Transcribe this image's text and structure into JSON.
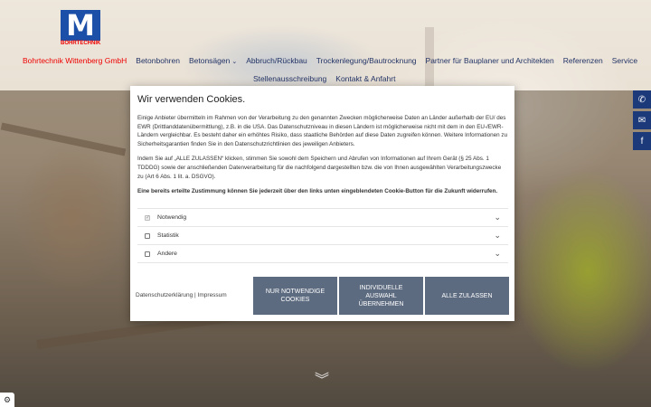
{
  "brand": {
    "logo_letter": "M",
    "logo_caption": "BOHRTECHNIK",
    "name": "Bohrtechnik Wittenberg GmbH"
  },
  "nav": {
    "row1": [
      {
        "label": "Bohrtechnik Wittenberg GmbH",
        "active": true
      },
      {
        "label": "Betonbohren"
      },
      {
        "label": "Betonsägen",
        "dropdown": true
      },
      {
        "label": "Abbruch/Rückbau"
      },
      {
        "label": "Trockenlegung/Bautrocknung"
      },
      {
        "label": "Partner für Bauplaner und Architekten"
      },
      {
        "label": "Referenzen"
      },
      {
        "label": "Service"
      }
    ],
    "row2": [
      {
        "label": "Stellenausschreibung"
      },
      {
        "label": "Kontakt & Anfahrt"
      }
    ]
  },
  "side_buttons": [
    {
      "icon": "phone-icon",
      "glyph": "✆"
    },
    {
      "icon": "email-icon",
      "glyph": "✉"
    },
    {
      "icon": "facebook-icon",
      "glyph": "f"
    }
  ],
  "cookie": {
    "title": "Wir verwenden Cookies.",
    "paragraph1": "Einige Anbieter übermitteln im Rahmen von der Verarbeitung zu den genannten Zwecken möglicherweise Daten an Länder außerhalb der EU/ des EWR (Drittlanddatenübermittlung), z.B. in die USA. Das Datenschutzniveau in diesen Ländern ist möglicherweise nicht mit dem in den EU-/EWR-Ländern vergleichbar. Es besteht daher ein erhöhtes Risiko, dass staatliche Behörden auf diese Daten zugreifen können. Weitere Informationen zu Sicherheitsgarantien finden Sie in den Datenschutzrichtlinien des jeweiligen Anbieters.",
    "paragraph2": "Indem Sie auf „ALLE ZULASSEN“ klicken, stimmen Sie sowohl dem Speichern und Abrufen von Informationen auf Ihrem Gerät (§ 25 Abs. 1 TDDDG) sowie der anschließenden Datenverarbeitung für die nachfolgend dargestellten bzw. die von Ihnen ausgewählten Verarbeitungszwecke zu (Art 6 Abs. 1 lit. a. DSGVO).",
    "paragraph3": "Eine bereits erteilte Zustimmung können Sie jederzeit über den links unten eingeblendeten Cookie-Button für die Zukunft widerrufen.",
    "options": [
      {
        "label": "Notwendig",
        "checked": true,
        "disabled": true
      },
      {
        "label": "Statistik",
        "checked": false,
        "disabled": false
      },
      {
        "label": "Andere",
        "checked": false,
        "disabled": false
      }
    ],
    "privacy_link": "Datenschutzerklärung",
    "separator": "|",
    "imprint_link": "Impressum",
    "btn_necessary": "NUR NOTWENDIGE COOKIES",
    "btn_individual": "INDIVIDUELLE AUSWAHL ÜBERNEHMEN",
    "btn_all": "ALLE ZULASSEN"
  },
  "scroll_glyph": "︾",
  "cookie_settings_glyph": "⚙",
  "colors": {
    "brand_blue": "#1c4fa7",
    "nav_text": "#223366",
    "active": "#ee0000",
    "button": "#5d6b80",
    "side_button": "#1c3a7a"
  }
}
